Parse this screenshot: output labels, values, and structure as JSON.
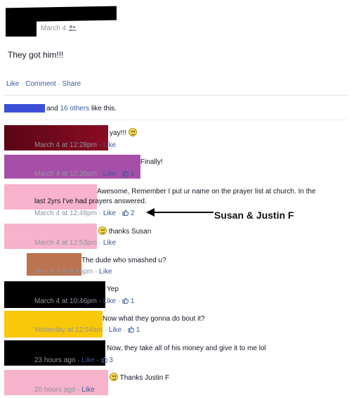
{
  "post": {
    "date": "March 4",
    "audience_icon": "friends-icon",
    "text": "They got him!!!",
    "actions": {
      "like": "Like",
      "comment": "Comment",
      "share": "Share"
    },
    "likes_text": "and ",
    "likes_others": "16 others",
    "likes_suffix": " like this."
  },
  "comments": [
    {
      "text": "yay!!!",
      "time": "March 4 at 12:28pm",
      "like": "Like",
      "likes": "",
      "emoji": "smiley",
      "redact_color": "#7a0a1e"
    },
    {
      "text": "Finally!",
      "time": "March 4 at 12:36pm",
      "like": "Like",
      "likes": "1",
      "redact_color": "#a64fa8"
    },
    {
      "text": "Awesome, Remember I put ur name on the prayer list at church. In the",
      "text2": "last 2yrs I've had prayers answered.",
      "time": "March 4 at 12:48pm",
      "like": "Like",
      "likes": "2",
      "redact_color": "#f7b2cc"
    },
    {
      "text": "thanks Susan",
      "time": "March 4 at 12:53pm",
      "like": "Like",
      "likes": "",
      "emoji": "smiley",
      "redact_color": "#f7b2cc"
    },
    {
      "text": "The dude who smashed u?",
      "time": "March 4 at 9:45pm",
      "like": "Like",
      "likes": "",
      "redact_color": "#bb7350"
    },
    {
      "text": "Yep",
      "time": "March 4 at 10:46pm",
      "like": "Like",
      "likes": "1",
      "redact_color": "#000000"
    },
    {
      "text": "Now what they gonna do bout it?",
      "time": "Yesterday at 12:54am",
      "like": "Like",
      "likes": "1",
      "redact_color": "#f9c80a"
    },
    {
      "text": "Now, they take all of his money and give it to me lol",
      "time": "23 hours ago",
      "like": "Like",
      "likes": "3",
      "redact_color": "#000000"
    },
    {
      "text": "Thanks Justin F",
      "time": "20 hours ago",
      "like": "Like",
      "likes": "",
      "emoji": "smiley",
      "redact_color": "#f7b2cc"
    }
  ],
  "annotation": {
    "text": "Susan & Justin F"
  },
  "colors": {
    "link": "#3b5998",
    "meta": "#90949c",
    "blue_redact": "#3b4fd6"
  }
}
